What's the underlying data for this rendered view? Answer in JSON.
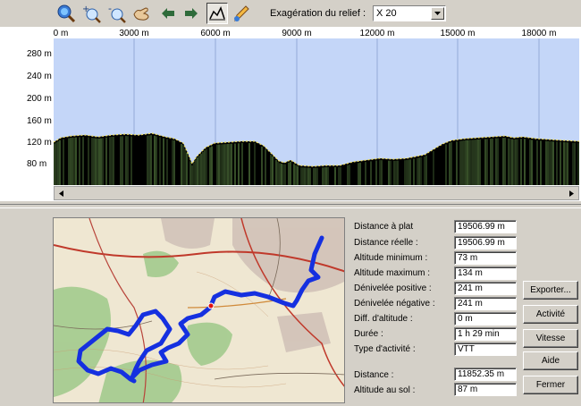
{
  "toolbar": {
    "icons": [
      "zoom-region-icon",
      "zoom-in-icon",
      "zoom-out-icon",
      "pan-hand-icon",
      "arrow-left-icon",
      "arrow-right-icon",
      "profile-view-icon",
      "measure-pencil-icon"
    ],
    "relief_label": "Exagération du relief :",
    "relief_value": "X 20"
  },
  "profile": {
    "x_ticks": [
      "0 m",
      "3000 m",
      "6000 m",
      "9000 m",
      "12000 m",
      "15000 m",
      "18000 m"
    ],
    "y_ticks": [
      "280 m",
      "240 m",
      "200 m",
      "160 m",
      "120 m",
      "80 m"
    ],
    "colors": {
      "sky": "#c4d6f8",
      "terrain": "#000000",
      "vegetation": "#8fcf6a",
      "highlight": "#f0e060",
      "grid": "#8aa0d0"
    }
  },
  "stats": [
    {
      "label": "Distance à plat",
      "value": "19506.99 m"
    },
    {
      "label": "Distance réelle :",
      "value": "19506.99 m"
    },
    {
      "label": "Altitude minimum :",
      "value": "73 m"
    },
    {
      "label": "Altitude maximum :",
      "value": "134 m"
    },
    {
      "label": "Dénivelée positive :",
      "value": "241 m"
    },
    {
      "label": "Dénivelée négative :",
      "value": "241 m"
    },
    {
      "label": "Diff. d'altitude :",
      "value": "0 m"
    },
    {
      "label": "Durée :",
      "value": "1 h 29 min"
    },
    {
      "label": "Type d'activité :",
      "value": "VTT"
    }
  ],
  "cursor_stats": [
    {
      "label": "Distance :",
      "value": "11852.35 m"
    },
    {
      "label": "Altitude au sol :",
      "value": "87 m"
    }
  ],
  "buttons": {
    "export": "Exporter...",
    "activity": "Activité",
    "speed": "Vitesse",
    "help": "Aide",
    "close": "Fermer"
  }
}
